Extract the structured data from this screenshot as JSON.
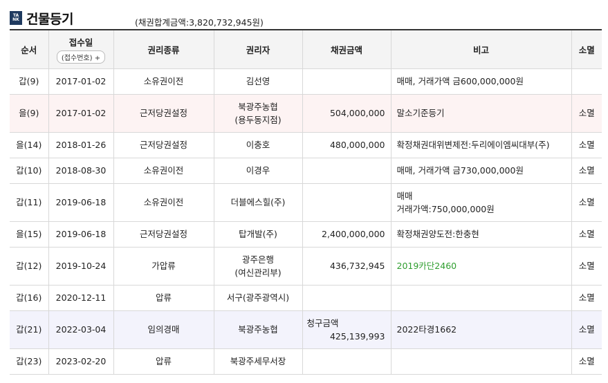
{
  "header": {
    "logo_line1": "TA",
    "logo_line2": "NK",
    "title": "건물등기",
    "total": "(채권합계금액:3,820,732,945원)"
  },
  "columns": {
    "order": "순서",
    "date": "접수일",
    "date_sub": "(접수번호) +",
    "type": "권리종류",
    "holder": "권리자",
    "amount": "채권금액",
    "note": "비고",
    "extinct": "소멸"
  },
  "rows": [
    {
      "order": "갑(9)",
      "date": "2017-01-02",
      "type": "소유권이전",
      "holder1": "김선영",
      "holder2": "",
      "amount_label": "",
      "amount": "",
      "note1": "매매, 거래가액 금600,000,000원",
      "note2": "",
      "extinct": ""
    },
    {
      "order": "을(9)",
      "date": "2017-01-02",
      "type": "근저당권설정",
      "holder1": "북광주농협",
      "holder2": "(용두동지점)",
      "amount_label": "",
      "amount": "504,000,000",
      "note1": "말소기준등기",
      "note2": "",
      "extinct": "소멸"
    },
    {
      "order": "을(14)",
      "date": "2018-01-26",
      "type": "근저당권설정",
      "holder1": "이충호",
      "holder2": "",
      "amount_label": "",
      "amount": "480,000,000",
      "note1": "확정채권대위변제전:두리에이엠씨대부(주)",
      "note2": "",
      "extinct": "소멸"
    },
    {
      "order": "갑(10)",
      "date": "2018-08-30",
      "type": "소유권이전",
      "holder1": "이경우",
      "holder2": "",
      "amount_label": "",
      "amount": "",
      "note1": "매매, 거래가액 금730,000,000원",
      "note2": "",
      "extinct": "소멸"
    },
    {
      "order": "갑(11)",
      "date": "2019-06-18",
      "type": "소유권이전",
      "holder1": "더블에스힐(주)",
      "holder2": "",
      "amount_label": "",
      "amount": "",
      "note1": "매매",
      "note2": "거래가액:750,000,000원",
      "extinct": "소멸"
    },
    {
      "order": "을(15)",
      "date": "2019-06-18",
      "type": "근저당권설정",
      "holder1": "탑개발(주)",
      "holder2": "",
      "amount_label": "",
      "amount": "2,400,000,000",
      "note1": "확정채권양도전:한충현",
      "note2": "",
      "extinct": "소멸"
    },
    {
      "order": "갑(12)",
      "date": "2019-10-24",
      "type": "가압류",
      "holder1": "광주은행",
      "holder2": "(여신관리부)",
      "amount_label": "",
      "amount": "436,732,945",
      "note1": "2019카단2460",
      "note2": "",
      "extinct": "소멸"
    },
    {
      "order": "갑(16)",
      "date": "2020-12-11",
      "type": "압류",
      "holder1": "서구(광주광역시)",
      "holder2": "",
      "amount_label": "",
      "amount": "",
      "note1": "",
      "note2": "",
      "extinct": "소멸"
    },
    {
      "order": "갑(21)",
      "date": "2022-03-04",
      "type": "임의경매",
      "holder1": "북광주농협",
      "holder2": "",
      "amount_label": "청구금액",
      "amount": "425,139,993",
      "note1": "2022타경1662",
      "note2": "",
      "extinct": "소멸"
    },
    {
      "order": "갑(23)",
      "date": "2023-02-20",
      "type": "압류",
      "holder1": "북광주세무서장",
      "holder2": "",
      "amount_label": "",
      "amount": "",
      "note1": "",
      "note2": "",
      "extinct": "소멸"
    }
  ],
  "colors": {
    "link_green": "#2f9e2f",
    "row_red": "#fdf3f3",
    "row_blue": "#f3f3fc",
    "header_bg": "#f4f4f4"
  }
}
